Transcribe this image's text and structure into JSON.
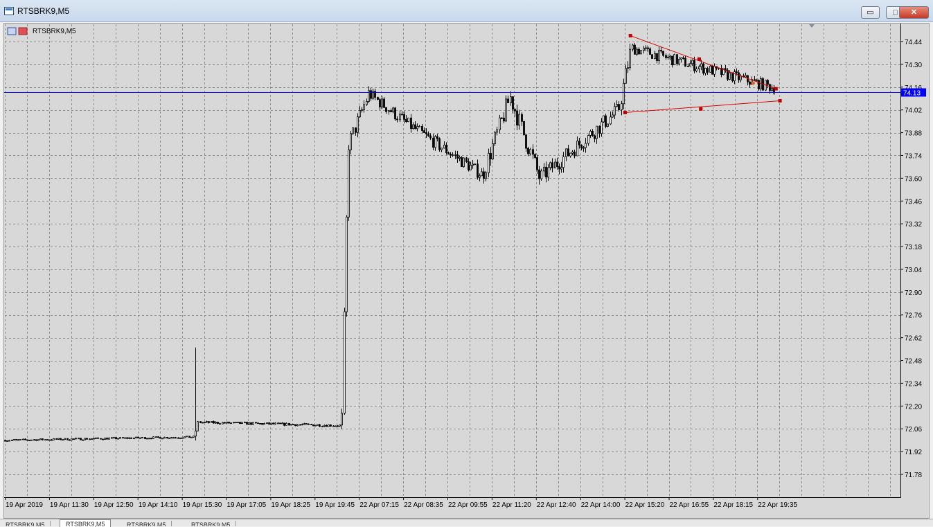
{
  "window": {
    "title": "RTSBRK9,M5",
    "buttons": {
      "minimize": "▭",
      "maximize": "□",
      "close": "✕"
    }
  },
  "chart_label": "RTSBRK9,M5",
  "tabs": [
    "RTSBRK9,M5",
    "RTSBRK9,M5",
    "RTSBRK9,M5",
    "RTSBRK9,M5"
  ],
  "active_tab": 1,
  "colors": {
    "background": "#d8d8d8",
    "grid": "#8c8c8c",
    "candle": "#000000",
    "price_line": "#0000ff",
    "trendline": "#dd0000",
    "price_tag_bg": "#0000ff",
    "price_tag_text": "#ffffff"
  },
  "chart_data": {
    "type": "candlestick",
    "symbol": "RTSBRK9",
    "timeframe": "M5",
    "y_ticks": [
      74.44,
      74.3,
      74.16,
      74.02,
      73.88,
      73.74,
      73.6,
      73.46,
      73.32,
      73.18,
      73.04,
      72.9,
      72.76,
      72.62,
      72.48,
      72.34,
      72.2,
      72.06,
      71.92,
      71.78
    ],
    "y_tick_labels": [
      "74.44",
      "74.30",
      "74.16",
      "74.02",
      "73.88",
      "73.74",
      "73.60",
      "73.46",
      "73.32",
      "73.18",
      "73.04",
      "72.90",
      "72.76",
      "72.62",
      "72.48",
      "72.34",
      "72.20",
      "72.06",
      "71.92",
      "71.78"
    ],
    "x_tick_labels": [
      "19 Apr 2019",
      "19 Apr 11:30",
      "19 Apr 12:50",
      "19 Apr 14:10",
      "19 Apr 15:30",
      "19 Apr 17:05",
      "19 Apr 18:25",
      "19 Apr 19:45",
      "22 Apr 07:15",
      "22 Apr 08:35",
      "22 Apr 09:55",
      "22 Apr 11:20",
      "22 Apr 12:40",
      "22 Apr 14:00",
      "22 Apr 15:20",
      "22 Apr 16:55",
      "22 Apr 18:15",
      "22 Apr 19:35"
    ],
    "current_price": "74.13",
    "current_price_value": 74.13,
    "triangle": {
      "upper": {
        "start": [
          0.6985,
          74.476
        ],
        "end": [
          0.861,
          74.15
        ],
        "midpoint_handle": [
          0.7753,
          74.332
        ]
      },
      "lower": {
        "start": [
          0.6925,
          74.004
        ],
        "end": [
          0.8655,
          74.076
        ],
        "midpoint_handle": [
          0.7771,
          74.026
        ]
      },
      "marker": [
        0.8356,
        74.184
      ]
    },
    "segments": [
      {
        "note": "19 Apr morning flat",
        "from": [
          0.0,
          71.99
        ],
        "to": [
          0.2115,
          72.01
        ],
        "noise": 0.006
      },
      {
        "note": "spike",
        "from": [
          0.2115,
          72.01
        ],
        "to": [
          0.215,
          72.12
        ],
        "noise": 0.04,
        "spike_high": 72.56
      },
      {
        "note": "19 Apr afternoon flat",
        "from": [
          0.215,
          72.1
        ],
        "to": [
          0.376,
          72.08
        ],
        "noise": 0.008
      },
      {
        "note": "gap up",
        "from": [
          0.376,
          72.08
        ],
        "to": [
          0.383,
          73.8
        ],
        "noise": 0.05
      },
      {
        "note": "rally",
        "from": [
          0.383,
          73.8
        ],
        "to": [
          0.406,
          74.12
        ],
        "noise": 0.05
      },
      {
        "note": "pullback",
        "from": [
          0.406,
          74.12
        ],
        "to": [
          0.453,
          73.92
        ],
        "noise": 0.04
      },
      {
        "note": "drift down",
        "from": [
          0.453,
          73.92
        ],
        "to": [
          0.533,
          73.62
        ],
        "noise": 0.04
      },
      {
        "note": "jump",
        "from": [
          0.533,
          73.62
        ],
        "to": [
          0.564,
          74.1
        ],
        "noise": 0.06
      },
      {
        "note": "sell-off",
        "from": [
          0.564,
          74.1
        ],
        "to": [
          0.597,
          73.6
        ],
        "noise": 0.06
      },
      {
        "note": "recovery",
        "from": [
          0.597,
          73.6
        ],
        "to": [
          0.685,
          74.02
        ],
        "noise": 0.05
      },
      {
        "note": "breakout",
        "from": [
          0.685,
          74.02
        ],
        "to": [
          0.7,
          74.42
        ],
        "noise": 0.06
      },
      {
        "note": "triangle",
        "from": [
          0.7,
          74.4
        ],
        "to": [
          0.862,
          74.15
        ],
        "noise": 0.035
      }
    ]
  }
}
